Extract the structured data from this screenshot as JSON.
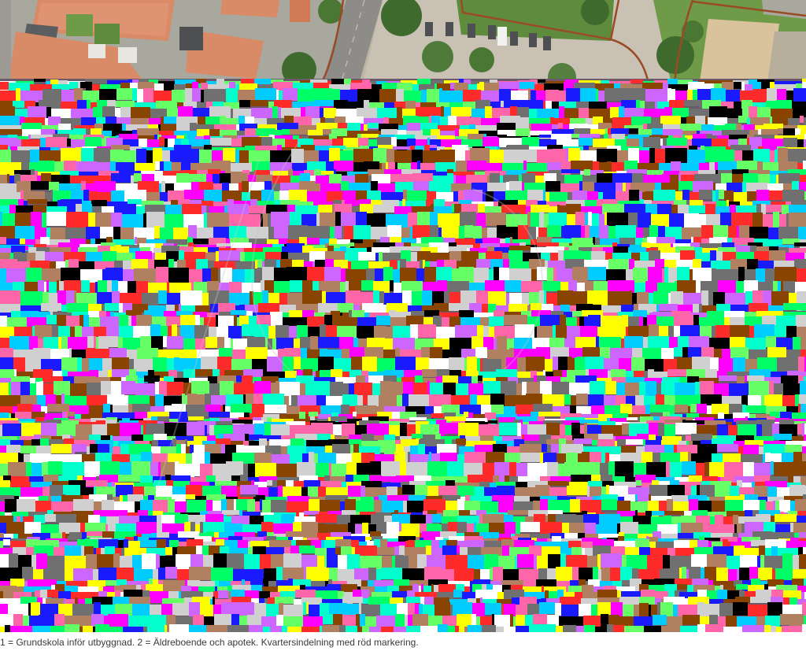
{
  "map": {
    "kind": "aerial-orthophoto",
    "palette": {
      "roof_tile": "#d98a66",
      "roof_dark": "#8a4a36",
      "asphalt": "#8d8c88",
      "paving": "#c9c2b4",
      "grass": "#5f8c3c",
      "tree": "#3f6a2e",
      "sand": "#d9c39c",
      "block_boundary": "#9a4a24",
      "corrupted_noise": [
        "#ff00ff",
        "#00ff66",
        "#00ccff",
        "#ffff00",
        "#ff2a2a",
        "#1a1aff",
        "#ffffff",
        "#000000",
        "#66ff66",
        "#cc66ff"
      ]
    },
    "overlay": {
      "block_boundaries": "red-brown outline lines",
      "image_corruption": "most of the photo is replaced by multicolored blocky pixel noise"
    }
  },
  "caption": {
    "text": "1 = Grundskola inför utbyggnad. 2 = Äldreboende och apotek. Kvartersindelning med röd markering."
  }
}
